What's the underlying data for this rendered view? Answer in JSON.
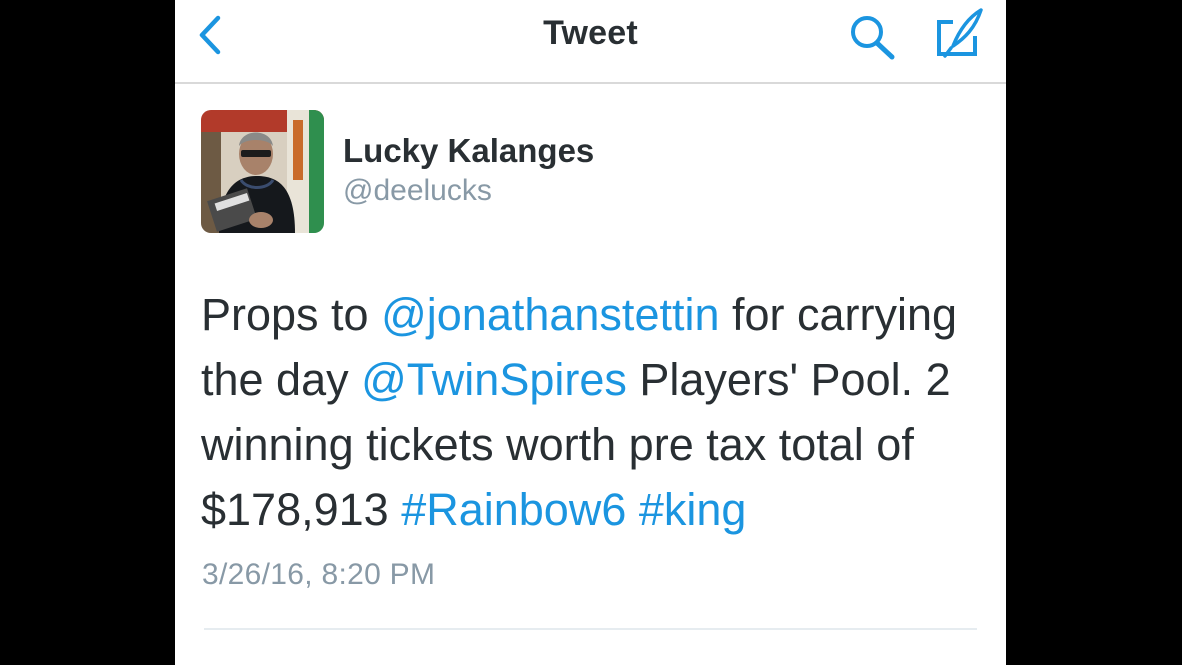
{
  "colors": {
    "accent": "#1b95e0",
    "text": "#292f33",
    "muted": "#8899a6",
    "background": "#ffffff",
    "frame": "#000000"
  },
  "navbar": {
    "title": "Tweet",
    "icons": [
      "chevron-left-icon",
      "search-icon",
      "compose-icon"
    ]
  },
  "tweet": {
    "author": {
      "name": "Lucky Kalanges",
      "handle": "@deelucks"
    },
    "lines": [
      [
        {
          "text": "Props to ",
          "link": false
        },
        {
          "text": "@jonathanstettin",
          "link": true
        },
        {
          "text": " for carrying",
          "link": false
        }
      ],
      [
        {
          "text": "the day ",
          "link": false
        },
        {
          "text": "@TwinSpires",
          "link": true
        },
        {
          "text": " Players' Pool. 2",
          "link": false
        }
      ],
      [
        {
          "text": "winning tickets worth pre tax total of",
          "link": false
        }
      ],
      [
        {
          "text": "$178,913 ",
          "link": false
        },
        {
          "text": "#Rainbow6",
          "link": true
        },
        {
          "text": " ",
          "link": false
        },
        {
          "text": "#king",
          "link": true
        }
      ]
    ],
    "timestamp": "3/26/16, 8:20 PM"
  }
}
